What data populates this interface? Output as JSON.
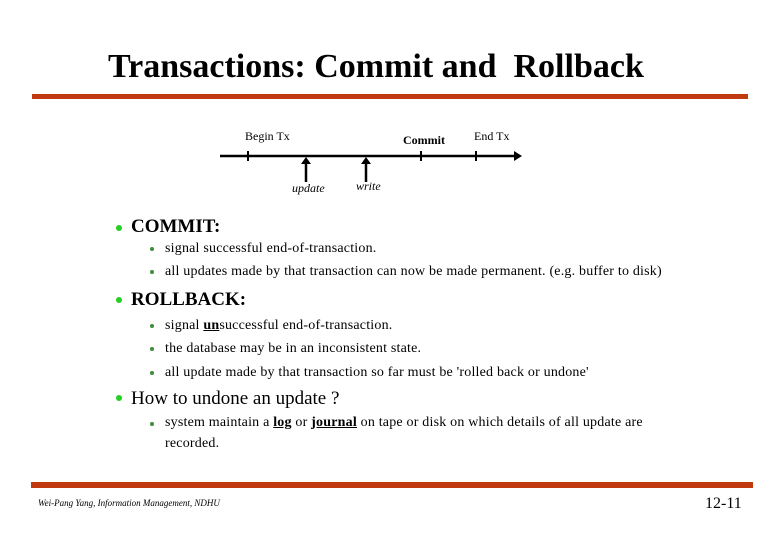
{
  "slide": {
    "title": "Transactions: Commit and  Rollback",
    "accent_color": "#c0390f",
    "bullet_color": "#22d022",
    "sub_bullet_color": "#3e8e3e"
  },
  "diagram": {
    "labels": {
      "begin": "Begin Tx",
      "commit": "Commit",
      "end": "End Tx",
      "update": "update",
      "write": "write"
    }
  },
  "sections": [
    {
      "heading": "COMMIT:",
      "items": [
        {
          "text": "signal successful end-of-transaction."
        },
        {
          "text": "all updates made by that transaction can now be made permanent.  (e.g. buffer to disk)"
        }
      ]
    },
    {
      "heading": "ROLLBACK:",
      "items": [
        {
          "emph": "un",
          "pre": "signal ",
          "post": "successful end-of-transaction."
        },
        {
          "text": "the database may be in an inconsistent state."
        },
        {
          "text": "all update made by that transaction so far must be  'rolled back or undone'"
        }
      ]
    },
    {
      "heading": "How to undone an update ?",
      "items": [
        {
          "p1": "system maintain a ",
          "k1": "log",
          "p2": " or ",
          "k2": "journal",
          "p3": " on tape or disk on which details of all update are",
          "p4": "recorded."
        }
      ]
    }
  ],
  "footer": {
    "author": "Wei-Pang Yang, Information Management, NDHU",
    "page_number": "12-11"
  }
}
